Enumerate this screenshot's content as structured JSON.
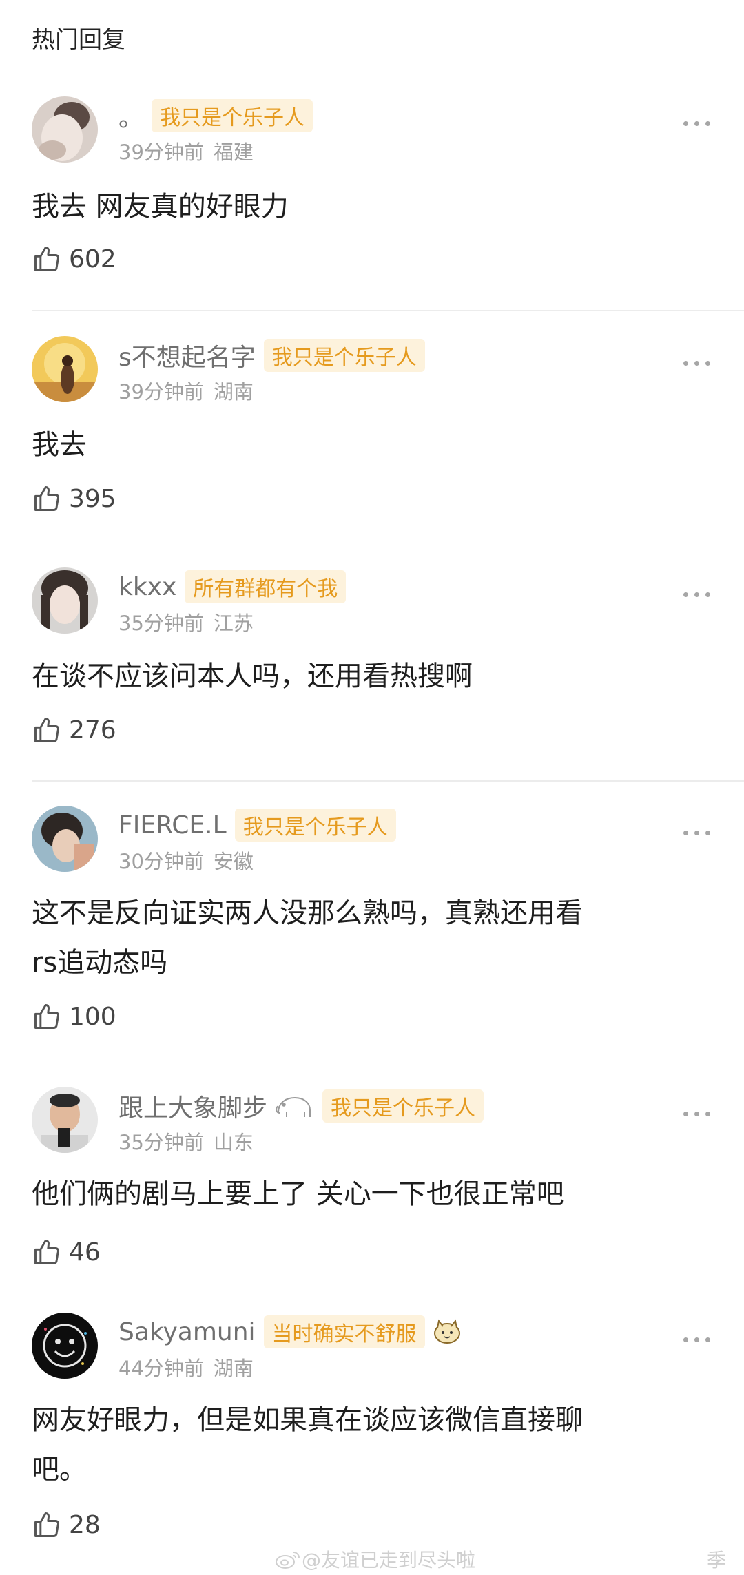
{
  "section_title": "热门回复",
  "comments": [
    {
      "username": "。",
      "badge": "我只是个乐子人",
      "time": "39分钟前",
      "location": "福建",
      "text": [
        "我去 网友真的好眼力"
      ],
      "likes": "602",
      "avatar": "woman-photo"
    },
    {
      "username": "s不想起名字",
      "badge": "我只是个乐子人",
      "time": "39分钟前",
      "location": "湖南",
      "text": [
        "我去"
      ],
      "likes": "395",
      "avatar": "sunset-illustration"
    },
    {
      "username": "kkxx",
      "badge": "所有群都有个我",
      "time": "35分钟前",
      "location": "江苏",
      "text": [
        "在谈不应该问本人吗，还用看热搜啊"
      ],
      "likes": "276",
      "avatar": "girl-portrait"
    },
    {
      "username": "FIERCE.L",
      "badge": "我只是个乐子人",
      "time": "30分钟前",
      "location": "安徽",
      "text": [
        "这不是反向证实两人没那么熟吗，真熟还用看",
        "rs追动态吗"
      ],
      "likes": "100",
      "avatar": "girl-photo"
    },
    {
      "username": "跟上大象脚步",
      "badge": "我只是个乐子人",
      "time": "35分钟前",
      "location": "山东",
      "text": [
        "他们俩的剧马上要上了 关心一下也很正常吧"
      ],
      "likes": "46",
      "avatar": "man-photo"
    },
    {
      "username": "Sakyamuni",
      "badge": "当时确实不舒服",
      "time": "44分钟前",
      "location": "湖南",
      "text": [
        "网友好眼力，但是如果真在谈应该微信直接聊",
        "吧。"
      ],
      "likes": "28",
      "avatar": "smiley-dark"
    }
  ],
  "watermark": "@友谊已走到尽头啦",
  "watermark_edge": "季",
  "icons": [
    "thumbs-up-icon",
    "more-dots-icon",
    "weibo-logo-icon",
    "elephant-icon",
    "cat-sticker-icon"
  ],
  "colors": {
    "badge_bg": "#fdf2dc",
    "badge_text": "#e59a1e",
    "meta": "#a0a0a0",
    "username": "#6f6f6f"
  }
}
